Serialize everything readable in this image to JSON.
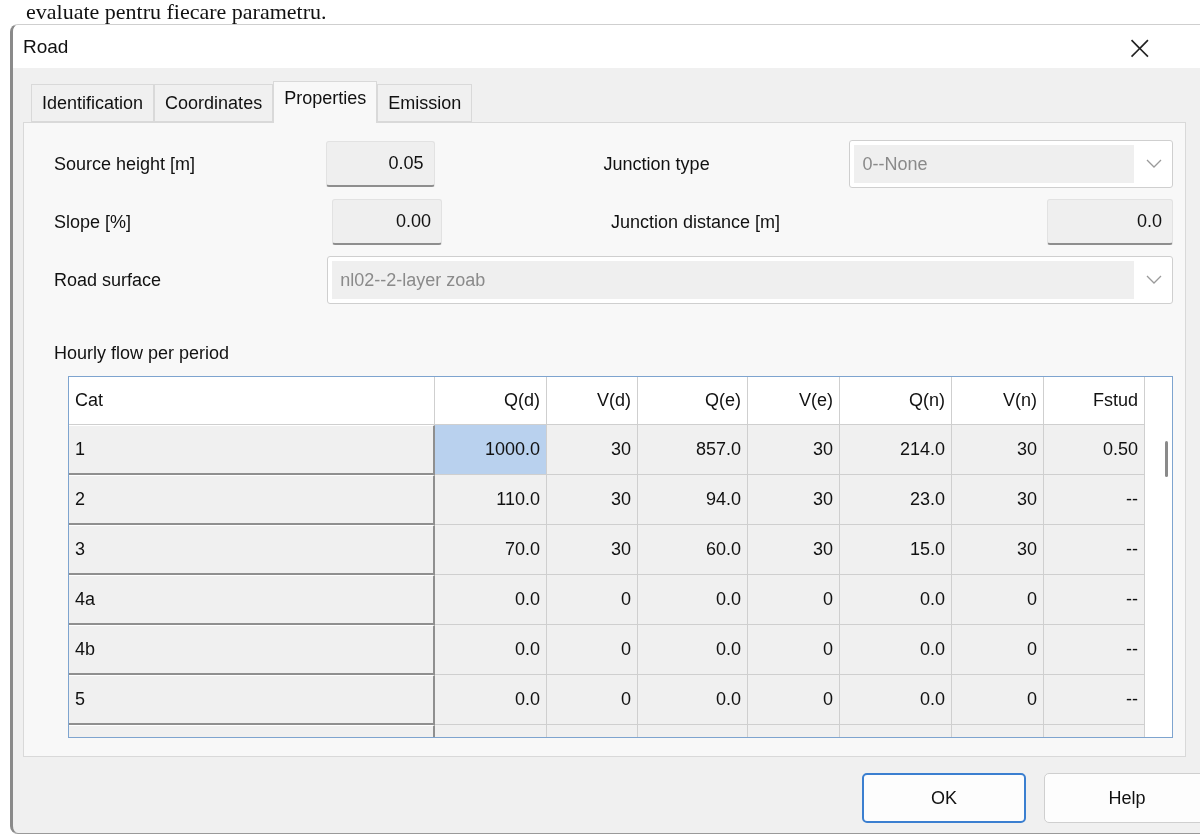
{
  "document_text": "evaluate pentru fiecare parametru.",
  "window": {
    "title": "Road",
    "close": "×"
  },
  "tabs": [
    {
      "label": "Identification",
      "selected": false
    },
    {
      "label": "Coordinates",
      "selected": false
    },
    {
      "label": "Properties",
      "selected": true
    },
    {
      "label": "Emission",
      "selected": false
    }
  ],
  "fields": {
    "source_height": {
      "label": "Source height [m]",
      "value": "0.05"
    },
    "slope": {
      "label": "Slope [%]",
      "value": "0.00"
    },
    "road_surface": {
      "label": "Road surface",
      "value": "nl02--2-layer zoab",
      "disabled": true
    },
    "junction_type": {
      "label": "Junction type",
      "value": "0--None",
      "disabled": true
    },
    "junction_distance": {
      "label": "Junction distance [m]",
      "value": "0.0"
    }
  },
  "table": {
    "title": "Hourly flow per period",
    "columns": [
      "Cat",
      "Q(d)",
      "V(d)",
      "Q(e)",
      "V(e)",
      "Q(n)",
      "V(n)",
      "Fstud"
    ],
    "rows": [
      {
        "cells": [
          {
            "text": "1",
            "selected": false
          },
          {
            "text": "1000.0",
            "selected": true
          },
          {
            "text": "30",
            "selected": false
          },
          {
            "text": "857.0",
            "selected": false
          },
          {
            "text": "30",
            "selected": false
          },
          {
            "text": "214.0",
            "selected": false
          },
          {
            "text": "30",
            "selected": false
          },
          {
            "text": "0.50",
            "selected": false
          }
        ]
      },
      {
        "cells": [
          {
            "text": "2",
            "selected": false
          },
          {
            "text": "110.0",
            "selected": false
          },
          {
            "text": "30",
            "selected": false
          },
          {
            "text": "94.0",
            "selected": false
          },
          {
            "text": "30",
            "selected": false
          },
          {
            "text": "23.0",
            "selected": false
          },
          {
            "text": "30",
            "selected": false
          },
          {
            "text": "--",
            "selected": false
          }
        ]
      },
      {
        "cells": [
          {
            "text": "3",
            "selected": false
          },
          {
            "text": "70.0",
            "selected": false
          },
          {
            "text": "30",
            "selected": false
          },
          {
            "text": "60.0",
            "selected": false
          },
          {
            "text": "30",
            "selected": false
          },
          {
            "text": "15.0",
            "selected": false
          },
          {
            "text": "30",
            "selected": false
          },
          {
            "text": "--",
            "selected": false
          }
        ]
      },
      {
        "cells": [
          {
            "text": "4a",
            "selected": false
          },
          {
            "text": "0.0",
            "selected": false
          },
          {
            "text": "0",
            "selected": false
          },
          {
            "text": "0.0",
            "selected": false
          },
          {
            "text": "0",
            "selected": false
          },
          {
            "text": "0.0",
            "selected": false
          },
          {
            "text": "0",
            "selected": false
          },
          {
            "text": "--",
            "selected": false
          }
        ]
      },
      {
        "cells": [
          {
            "text": "4b",
            "selected": false
          },
          {
            "text": "0.0",
            "selected": false
          },
          {
            "text": "0",
            "selected": false
          },
          {
            "text": "0.0",
            "selected": false
          },
          {
            "text": "0",
            "selected": false
          },
          {
            "text": "0.0",
            "selected": false
          },
          {
            "text": "0",
            "selected": false
          },
          {
            "text": "--",
            "selected": false
          }
        ]
      },
      {
        "cells": [
          {
            "text": "5",
            "selected": false
          },
          {
            "text": "0.0",
            "selected": false
          },
          {
            "text": "0",
            "selected": false
          },
          {
            "text": "0.0",
            "selected": false
          },
          {
            "text": "0",
            "selected": false
          },
          {
            "text": "0.0",
            "selected": false
          },
          {
            "text": "0",
            "selected": false
          },
          {
            "text": "--",
            "selected": false
          }
        ]
      }
    ]
  },
  "buttons": [
    {
      "label": "OK",
      "default": true
    },
    {
      "label": "Help",
      "default": false
    }
  ]
}
